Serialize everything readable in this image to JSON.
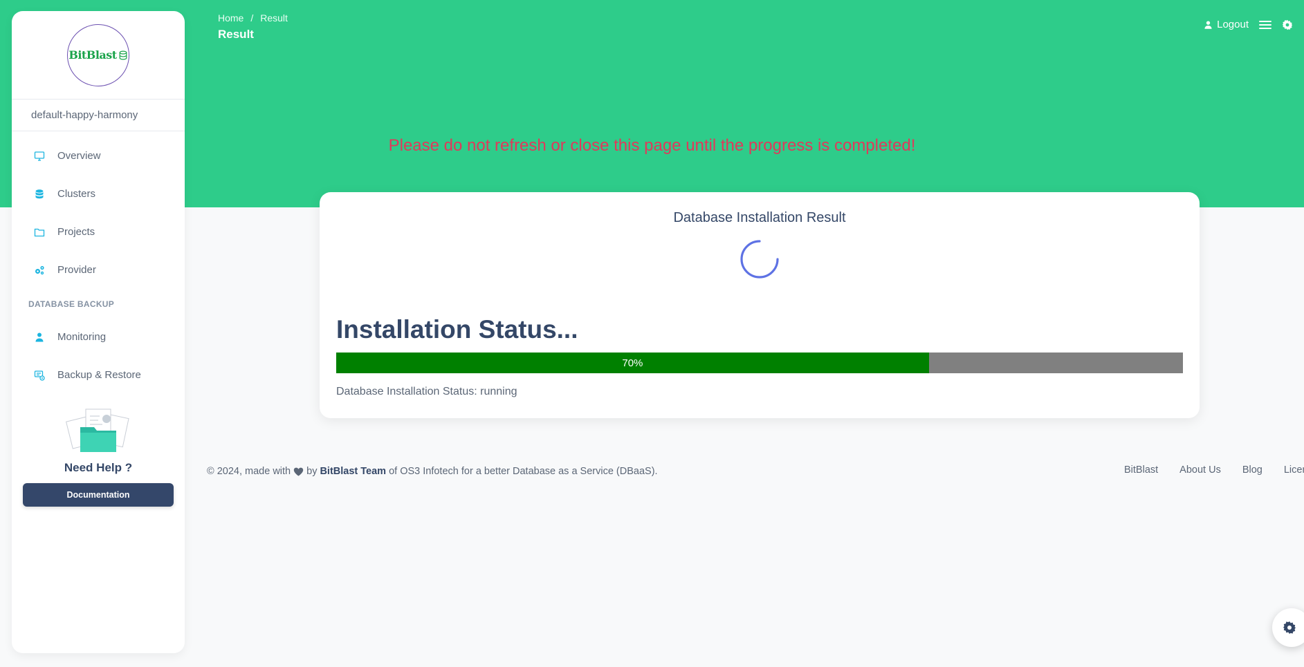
{
  "brand": {
    "logo_text": "BitBlast"
  },
  "sidebar": {
    "workspace": "default-happy-harmony",
    "items": [
      {
        "label": "Overview",
        "icon": "monitor-icon"
      },
      {
        "label": "Clusters",
        "icon": "database-icon"
      },
      {
        "label": "Projects",
        "icon": "folder-icon"
      },
      {
        "label": "Provider",
        "icon": "gears-icon"
      }
    ],
    "section_label": "DATABASE BACKUP",
    "backup_items": [
      {
        "label": "Monitoring",
        "icon": "user-icon"
      },
      {
        "label": "Backup & Restore",
        "icon": "backup-icon"
      }
    ],
    "help_title": "Need Help ?",
    "doc_button": "Documentation"
  },
  "header": {
    "breadcrumb": [
      "Home",
      "Result"
    ],
    "breadcrumb_sep": "/",
    "title": "Result",
    "logout_label": "Logout"
  },
  "warning": "Please do not refresh or close this page until the progress is completed!",
  "card": {
    "title": "Database Installation Result",
    "status_title": "Installation Status...",
    "progress_label": "70%",
    "progress_fraction": 0.7,
    "status_line": "Database Installation Status: running"
  },
  "footer": {
    "prefix": "© 2024, made with",
    "by": "by",
    "team": "BitBlast Team",
    "suffix": "of OS3 Infotech for a better Database as a Service (DBaaS).",
    "links": [
      "BitBlast",
      "About Us",
      "Blog",
      "License"
    ]
  },
  "colors": {
    "header_bg": "#2ecc8a",
    "warning": "#e0395b",
    "progress_fill": "#008000",
    "progress_track": "#808080",
    "icon_accent": "#1cb5e0"
  }
}
